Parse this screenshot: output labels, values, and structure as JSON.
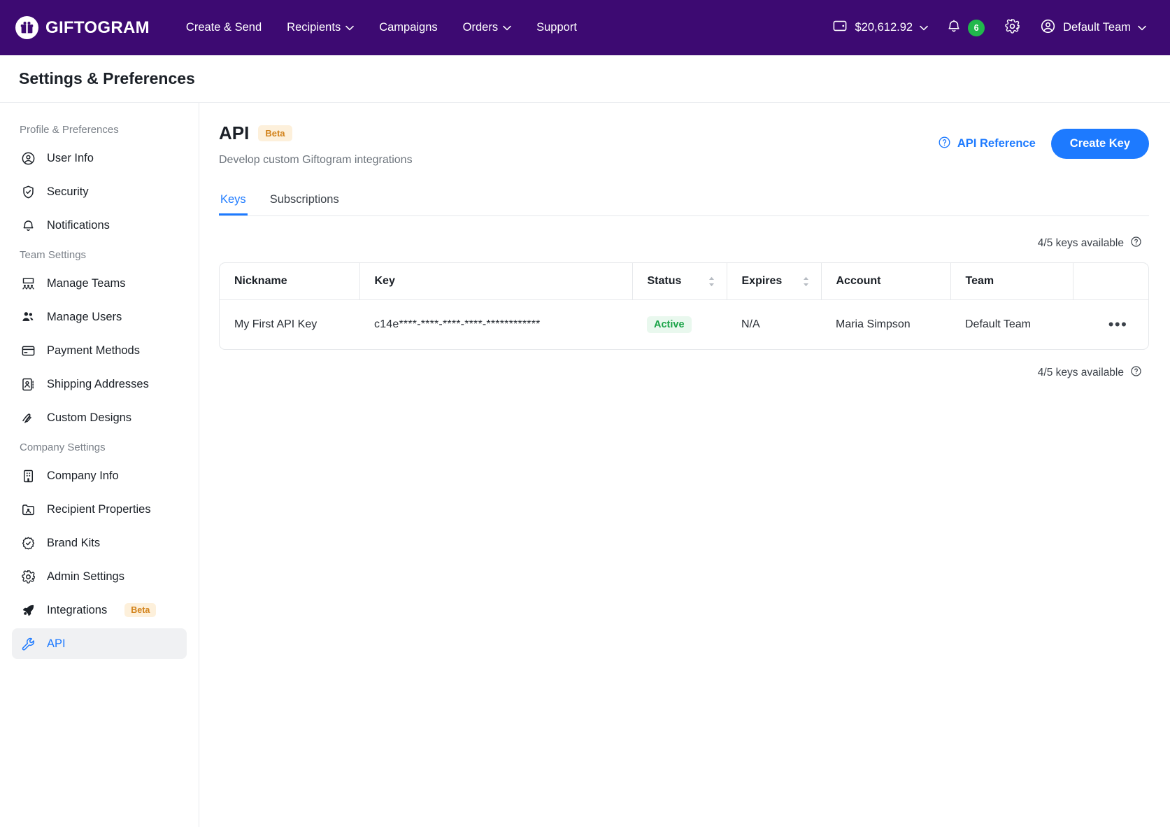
{
  "topnav": {
    "brand": "GIFTOGRAM",
    "brand_icon": "gift-icon",
    "links": [
      {
        "label": "Create & Send",
        "caret": false
      },
      {
        "label": "Recipients",
        "caret": true
      },
      {
        "label": "Campaigns",
        "caret": false
      },
      {
        "label": "Orders",
        "caret": true
      },
      {
        "label": "Support",
        "caret": false
      }
    ],
    "balance": "$20,612.92",
    "notifications_count": "6",
    "team": "Default Team",
    "accent_purple": "#3d0a72",
    "badge_green": "#21b84c"
  },
  "page": {
    "title": "Settings & Preferences"
  },
  "sidebar": {
    "groups": [
      {
        "title": "Profile & Preferences",
        "items": [
          {
            "label": "User Info",
            "icon": "user-circle-icon",
            "active": false
          },
          {
            "label": "Security",
            "icon": "shield-check-icon",
            "active": false
          },
          {
            "label": "Notifications",
            "icon": "bell-icon",
            "active": false
          }
        ]
      },
      {
        "title": "Team Settings",
        "items": [
          {
            "label": "Manage Teams",
            "icon": "teams-icon",
            "active": false
          },
          {
            "label": "Manage Users",
            "icon": "users-icon",
            "active": false
          },
          {
            "label": "Payment Methods",
            "icon": "credit-card-icon",
            "active": false
          },
          {
            "label": "Shipping Addresses",
            "icon": "address-book-icon",
            "active": false
          },
          {
            "label": "Custom Designs",
            "icon": "scribble-icon",
            "active": false
          }
        ]
      },
      {
        "title": "Company Settings",
        "items": [
          {
            "label": "Company Info",
            "icon": "building-icon",
            "active": false
          },
          {
            "label": "Recipient Properties",
            "icon": "contact-card-icon",
            "active": false
          },
          {
            "label": "Brand Kits",
            "icon": "badge-check-icon",
            "active": false
          },
          {
            "label": "Admin Settings",
            "icon": "gear-icon",
            "active": false
          },
          {
            "label": "Integrations",
            "icon": "rocket-icon",
            "active": false,
            "badge": "Beta"
          },
          {
            "label": "API",
            "icon": "wrench-icon",
            "active": true
          }
        ]
      }
    ]
  },
  "main": {
    "title": "API",
    "title_badge": "Beta",
    "subtitle": "Develop custom Giftogram integrations",
    "api_reference_label": "API Reference",
    "create_key_label": "Create Key",
    "tabs": [
      {
        "label": "Keys",
        "active": true
      },
      {
        "label": "Subscriptions",
        "active": false
      }
    ],
    "keys_available_top": "4/5 keys available",
    "keys_available_bottom": "4/5 keys available",
    "table": {
      "columns": [
        {
          "label": "Nickname",
          "sortable": false
        },
        {
          "label": "Key",
          "sortable": false
        },
        {
          "label": "Status",
          "sortable": true
        },
        {
          "label": "Expires",
          "sortable": true
        },
        {
          "label": "Account",
          "sortable": false
        },
        {
          "label": "Team",
          "sortable": false
        },
        {
          "label": "",
          "sortable": false
        }
      ],
      "rows": [
        {
          "nickname": "My First API Key",
          "key": "c14e****-****-****-****-************",
          "status": "Active",
          "expires": "N/A",
          "account": "Maria Simpson",
          "team": "Default Team",
          "actions": "•••"
        }
      ]
    },
    "accent_blue": "#1d7aff",
    "status_green": "#19a347",
    "beta_orange": "#d2821a"
  }
}
